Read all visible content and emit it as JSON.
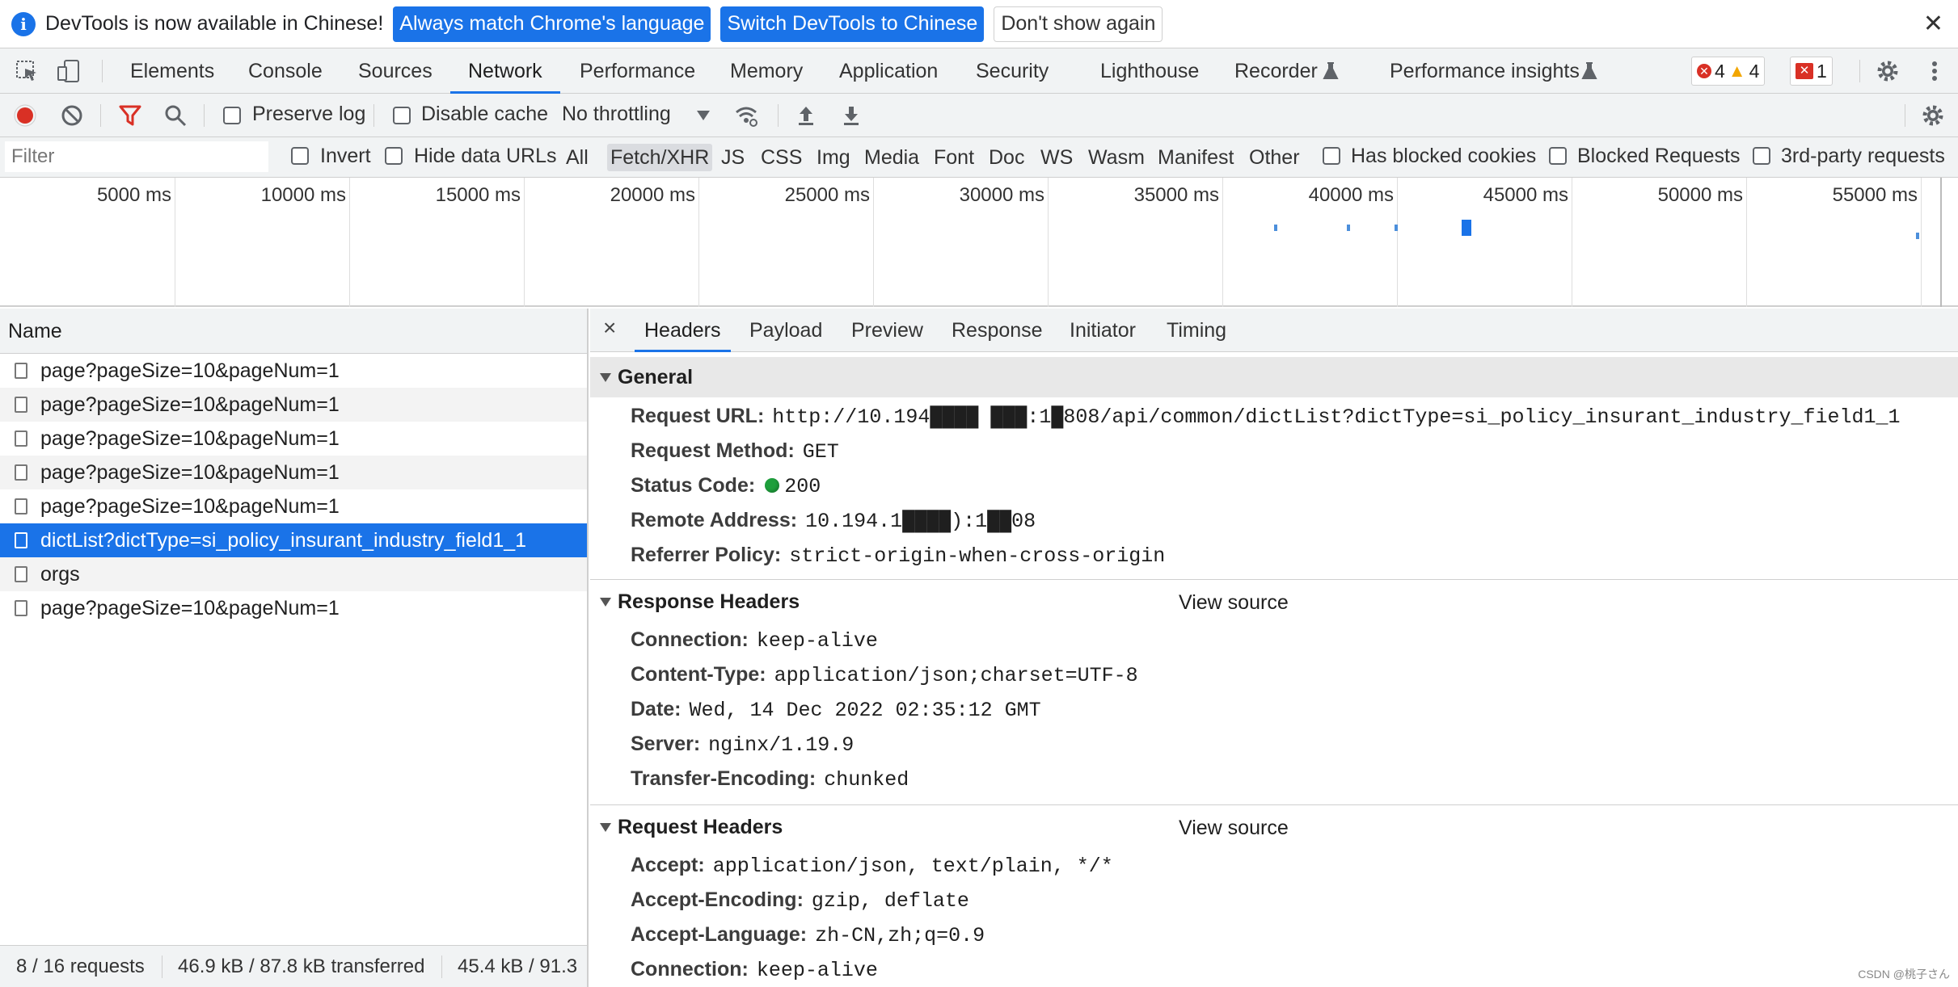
{
  "infobar": {
    "message": "DevTools is now available in Chinese!",
    "btn_match": "Always match Chrome's language",
    "btn_switch": "Switch DevTools to Chinese",
    "btn_dismiss": "Don't show again",
    "close": "✕"
  },
  "tabs": [
    "Elements",
    "Console",
    "Sources",
    "Network",
    "Performance",
    "Memory",
    "Application",
    "Security",
    "Lighthouse",
    "Recorder",
    "Performance insights"
  ],
  "active_tab": "Network",
  "issues": {
    "errors": "4",
    "warnings": "4",
    "blocked": "1"
  },
  "toolbar": {
    "preserve_log": "Preserve log",
    "disable_cache": "Disable cache",
    "throttling": "No throttling"
  },
  "filter": {
    "placeholder": "Filter",
    "invert": "Invert",
    "hide_data_urls": "Hide data URLs",
    "types": [
      "All",
      "Fetch/XHR",
      "JS",
      "CSS",
      "Img",
      "Media",
      "Font",
      "Doc",
      "WS",
      "Wasm",
      "Manifest",
      "Other"
    ],
    "active_type": "Fetch/XHR",
    "has_blocked_cookies": "Has blocked cookies",
    "blocked_requests": "Blocked Requests",
    "third_party": "3rd-party requests"
  },
  "overview": {
    "ticks": [
      "5000 ms",
      "10000 ms",
      "15000 ms",
      "20000 ms",
      "25000 ms",
      "30000 ms",
      "35000 ms",
      "40000 ms",
      "45000 ms",
      "50000 ms",
      "55000 ms"
    ]
  },
  "requests": {
    "column_name": "Name",
    "rows": [
      "page?pageSize=10&pageNum=1",
      "page?pageSize=10&pageNum=1",
      "page?pageSize=10&pageNum=1",
      "page?pageSize=10&pageNum=1",
      "page?pageSize=10&pageNum=1",
      "dictList?dictType=si_policy_insurant_industry_field1_1",
      "orgs",
      "page?pageSize=10&pageNum=1"
    ],
    "selected_index": 5,
    "status": {
      "count": "8 / 16 requests",
      "transferred": "46.9 kB / 87.8 kB transferred",
      "resources": "45.4 kB / 91.3"
    }
  },
  "details": {
    "close": "×",
    "tabs": [
      "Headers",
      "Payload",
      "Preview",
      "Response",
      "Initiator",
      "Timing"
    ],
    "active_tab": "Headers",
    "general": {
      "title": "General",
      "request_url_k": "Request URL:",
      "request_url_v": "http://10.194████ ███:1█808/api/common/dictList?dictType=si_policy_insurant_industry_field1_1",
      "method_k": "Request Method:",
      "method_v": "GET",
      "status_k": "Status Code:",
      "status_v": "200",
      "remote_k": "Remote Address:",
      "remote_v": "10.194.1████):1██08",
      "referrer_k": "Referrer Policy:",
      "referrer_v": "strict-origin-when-cross-origin"
    },
    "response_headers": {
      "title": "Response Headers",
      "view_source": "View source",
      "items": [
        [
          "Connection:",
          "keep-alive"
        ],
        [
          "Content-Type:",
          "application/json;charset=UTF-8"
        ],
        [
          "Date:",
          "Wed, 14 Dec 2022 02:35:12 GMT"
        ],
        [
          "Server:",
          "nginx/1.19.9"
        ],
        [
          "Transfer-Encoding:",
          "chunked"
        ]
      ]
    },
    "request_headers": {
      "title": "Request Headers",
      "view_source": "View source",
      "items": [
        [
          "Accept:",
          "application/json, text/plain, */*"
        ],
        [
          "Accept-Encoding:",
          "gzip, deflate"
        ],
        [
          "Accept-Language:",
          "zh-CN,zh;q=0.9"
        ],
        [
          "Connection:",
          "keep-alive"
        ]
      ]
    }
  },
  "watermark": "CSDN @桃子さん"
}
